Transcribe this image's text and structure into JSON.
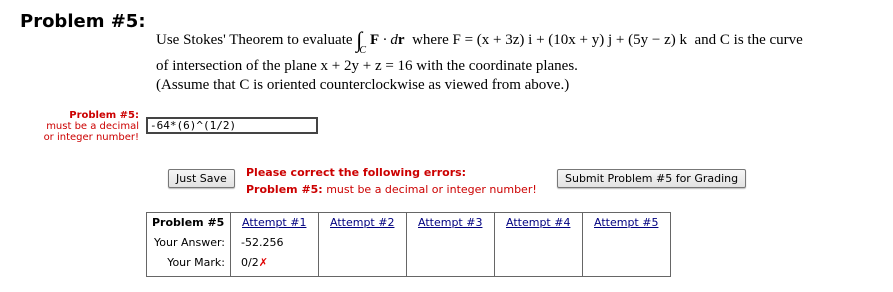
{
  "problem": {
    "heading": "Problem #5:",
    "text_prefix": "Use Stokes' Theorem to evaluate",
    "integral_symbol": "∫",
    "integral_sub": "C",
    "integrand_F": "F",
    "integrand_dot": " · d",
    "integrand_r": "r",
    "where": "where",
    "F_eq": "F = (x + 3z) i + (10x + y) j + (5y − z) k",
    "and_c": "and C is the curve",
    "line2": "of intersection of the plane x + 2y + z = 16 with the coordinate planes.",
    "line3": "(Assume that C is oriented counterclockwise as viewed from above.)"
  },
  "side_label": {
    "title": "Problem #5:",
    "line1": "must be a decimal",
    "line2": "or integer number!"
  },
  "answer_input": {
    "value": "-64*(6)^(1/2)"
  },
  "buttons": {
    "just_save": "Just Save",
    "submit": "Submit Problem #5 for Grading"
  },
  "errors": {
    "heading": "Please correct the following errors:",
    "item_prefix": "Problem #5:",
    "item_text": " must be a decimal or integer number!"
  },
  "attempts": {
    "header": "Problem #5",
    "answer_label": "Your Answer:",
    "mark_label": "Your Mark:",
    "items": [
      {
        "label": "Attempt #1",
        "answer": "-52.256",
        "mark": "0/2",
        "mark_symbol": "✗"
      },
      {
        "label": "Attempt #2",
        "answer": "",
        "mark": "",
        "mark_symbol": ""
      },
      {
        "label": "Attempt #3",
        "answer": "",
        "mark": "",
        "mark_symbol": ""
      },
      {
        "label": "Attempt #4",
        "answer": "",
        "mark": "",
        "mark_symbol": ""
      },
      {
        "label": "Attempt #5",
        "answer": "",
        "mark": "",
        "mark_symbol": ""
      }
    ]
  },
  "colors": {
    "error_red": "#cc0000",
    "link_blue": "#000080",
    "x_red": "#e00000"
  }
}
